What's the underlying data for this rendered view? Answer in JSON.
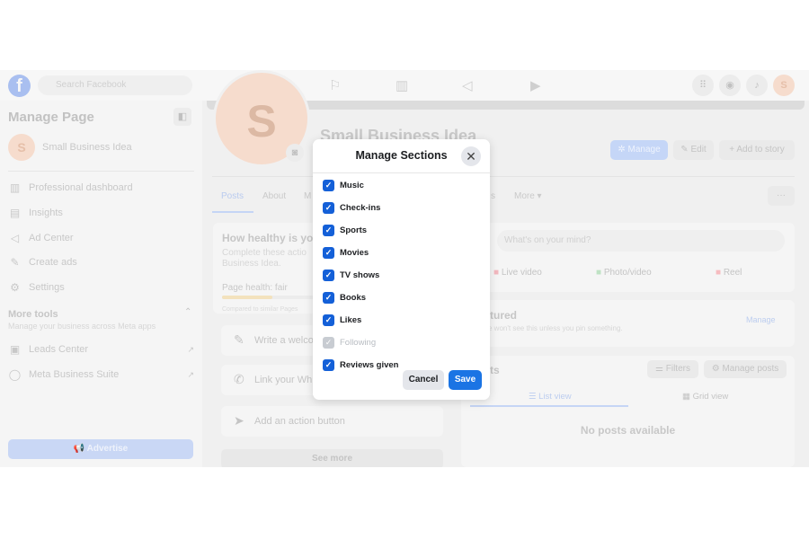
{
  "topbar": {
    "logo": "f",
    "search_placeholder": "Search Facebook",
    "nav_icons": [
      "home-icon",
      "flag-icon",
      "chart-icon",
      "megaphone-icon",
      "video-icon"
    ],
    "right_icons": [
      "menu-grid-icon",
      "messenger-icon",
      "bell-icon"
    ],
    "avatar_letter": "S"
  },
  "sidebar": {
    "title": "Manage Page",
    "page_name": "Small Business Idea",
    "avatar_letter": "S",
    "items": [
      {
        "label": "Professional dashboard",
        "icon": "dashboard-icon"
      },
      {
        "label": "Insights",
        "icon": "insights-icon"
      },
      {
        "label": "Ad Center",
        "icon": "megaphone-icon"
      },
      {
        "label": "Create ads",
        "icon": "edit-icon"
      },
      {
        "label": "Settings",
        "icon": "gear-icon"
      }
    ],
    "more_tools_title": "More tools",
    "more_tools_subtitle": "Manage your business across Meta apps",
    "tools": [
      {
        "label": "Leads Center"
      },
      {
        "label": "Meta Business Suite"
      }
    ],
    "advertise_label": "Advertise"
  },
  "profile": {
    "avatar_letter": "S",
    "name": "Small Business Idea",
    "manage_label": "Manage",
    "edit_label": "Edit",
    "add_story_label": "Add to story",
    "tabs": [
      "Posts",
      "About",
      "M",
      "s",
      "More ▾"
    ],
    "more_dots": "···"
  },
  "health": {
    "title": "How healthy is yo",
    "desc": "Complete these actio",
    "desc2": "Business Idea.",
    "status": "Page health: fair",
    "progress": 0.4,
    "compare": "Compared to similar Pages",
    "actions": [
      "Write a welco",
      "Link your Wh",
      "Add an action button"
    ],
    "see_more": "See more"
  },
  "composer": {
    "placeholder": "What's on your mind?",
    "live": "Live video",
    "photo": "Photo/video",
    "reel": "Reel"
  },
  "featured": {
    "title": "tured",
    "desc": "e won't see this unless you pin something.",
    "manage": "Manage"
  },
  "posts": {
    "title": "ts",
    "filters": "Filters",
    "manage_posts": "Manage posts",
    "list_view": "List view",
    "grid_view": "Grid view",
    "empty": "No posts available"
  },
  "modal": {
    "title": "Manage Sections",
    "options": [
      {
        "label": "Music",
        "checked": true,
        "disabled": false
      },
      {
        "label": "Check-ins",
        "checked": true,
        "disabled": false
      },
      {
        "label": "Sports",
        "checked": true,
        "disabled": false
      },
      {
        "label": "Movies",
        "checked": true,
        "disabled": false
      },
      {
        "label": "TV shows",
        "checked": true,
        "disabled": false
      },
      {
        "label": "Books",
        "checked": true,
        "disabled": false
      },
      {
        "label": "Likes",
        "checked": true,
        "disabled": false
      },
      {
        "label": "Following",
        "checked": true,
        "disabled": true
      },
      {
        "label": "Reviews given",
        "checked": true,
        "disabled": false
      }
    ],
    "cancel_label": "Cancel",
    "save_label": "Save"
  },
  "colors": {
    "accent": "#1b74e4",
    "checkbox": "#1460d8"
  }
}
